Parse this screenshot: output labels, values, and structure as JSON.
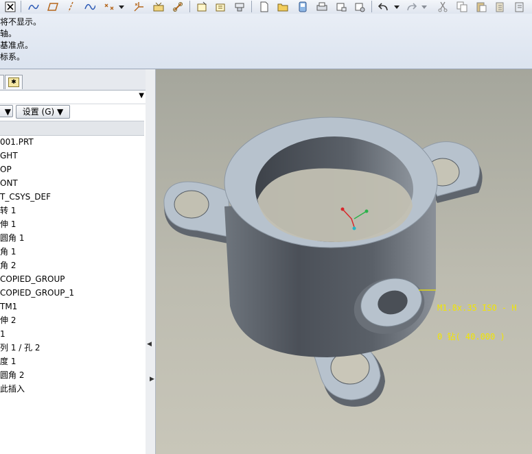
{
  "toolbar": {
    "icons": [
      "close-icon",
      "sketch-datum-icon",
      "plane-icon",
      "axis-icon",
      "curve-icon",
      "point-icon",
      "dropdown-arrow-icon",
      "csys-icon",
      "analysis-icon",
      "link-icon",
      "note-icon",
      "note-edit-icon",
      "stamp-icon",
      "new-file-icon",
      "open-folder-icon",
      "save-icon",
      "print-icon",
      "mail-icon",
      "mail-attach-icon",
      "undo-icon",
      "undo-dropdown-icon",
      "redo-icon",
      "redo-dropdown-icon",
      "cut-icon",
      "copy-icon",
      "paste-icon",
      "paste-special-icon",
      "regenerate-icon"
    ]
  },
  "messages": [
    "将不显示。",
    "轴。",
    "基准点。",
    "标系。"
  ],
  "left_panel": {
    "settings_button": "设置 (G) ▼",
    "left_button": "▼",
    "tree": {
      "items": [
        "001.PRT",
        "GHT",
        "OP",
        "ONT",
        "T_CSYS_DEF",
        "转 1",
        "伸 1",
        "圆角 1",
        "角 1",
        "角 2",
        "COPIED_GROUP",
        "COPIED_GROUP_1",
        "TM1",
        "伸 2",
        "1",
        "列 1 / 孔 2",
        "度 1",
        "圆角 2",
        "此插入"
      ]
    }
  },
  "viewport": {
    "annotation_line1": "M1.8x.35 ISO - H",
    "annotation_line2": "0 钻( 40.000 )",
    "annotation_color": "#f2e600"
  },
  "colors": {
    "part_fill": "#b7c2cd",
    "viewport_bg": "#b5b4a9"
  }
}
